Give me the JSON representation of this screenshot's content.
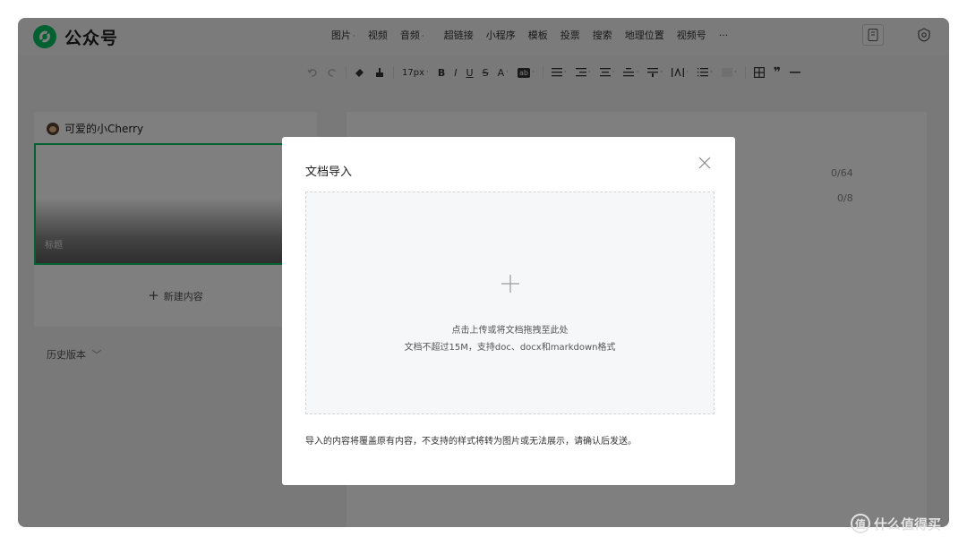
{
  "app": {
    "name": "公众号",
    "brand_color": "#07c160"
  },
  "insert_menu": [
    {
      "label": "图片",
      "dropdown": true
    },
    {
      "label": "视频",
      "dropdown": false
    },
    {
      "label": "音频",
      "dropdown": true
    },
    {
      "label": "超链接",
      "dropdown": false
    },
    {
      "label": "小程序",
      "dropdown": false
    },
    {
      "label": "模板",
      "dropdown": false
    },
    {
      "label": "投票",
      "dropdown": false
    },
    {
      "label": "搜索",
      "dropdown": false
    },
    {
      "label": "地理位置",
      "dropdown": false
    },
    {
      "label": "视频号",
      "dropdown": false
    },
    {
      "label": "···",
      "dropdown": false
    }
  ],
  "format_toolbar": {
    "font_size": "17px",
    "bold": "B",
    "italic": "I",
    "underline": "U",
    "strike": "S",
    "font_color": "A",
    "code": "ab"
  },
  "sidebar": {
    "account_name": "可爱的小Cherry",
    "article_title_placeholder": "标题",
    "new_content_label": "新建内容",
    "history_label": "历史版本"
  },
  "editor": {
    "title_counter": "0/64",
    "author_counter": "0/8"
  },
  "dialog": {
    "title": "文档导入",
    "dropzone_line1": "点击上传或将文档拖拽至此处",
    "dropzone_line2": "文档不超过15M，支持doc、docx和markdown格式",
    "note": "导入的内容将覆盖原有内容，不支持的样式将转为图片或无法展示，请确认后发送。"
  },
  "watermark": {
    "badge": "值",
    "text": "什么值得买"
  }
}
